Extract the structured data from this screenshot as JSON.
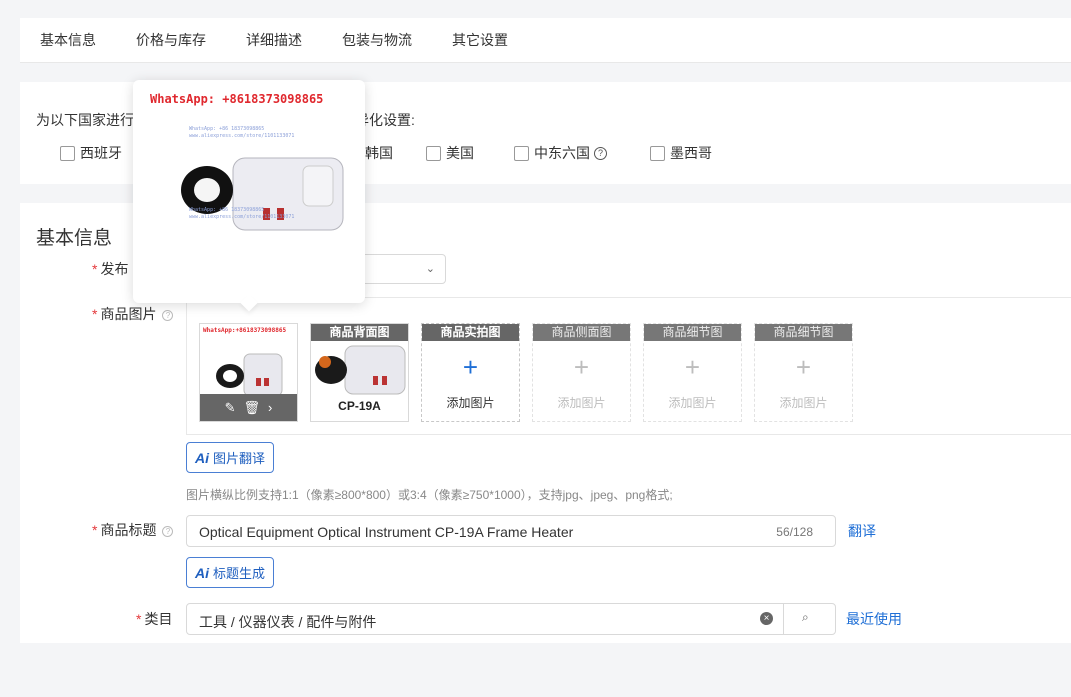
{
  "tabs": [
    "基本信息",
    "价格与库存",
    "详细描述",
    "包装与物流",
    "其它设置"
  ],
  "countries": {
    "label": "为以下国家进行差异化设置:",
    "label_visible_left": "为以下国家进行",
    "label_visible_right": "差异化设置:",
    "options": [
      "西班牙",
      "韩国",
      "美国",
      "中东六国",
      "墨西哥"
    ],
    "help_icon": "question-circle-icon"
  },
  "basic": {
    "title": "基本信息",
    "publish_label": "发布",
    "images_label": "商品图片",
    "image_slots": [
      {
        "header": "",
        "text": ""
      },
      {
        "header": "商品背面图",
        "text": "CP-19A"
      },
      {
        "header": "商品实拍图",
        "text": "添加图片"
      },
      {
        "header": "商品侧面图",
        "text": "添加图片"
      },
      {
        "header": "商品细节图",
        "text": "添加图片"
      },
      {
        "header": "商品细节图",
        "text": "添加图片"
      }
    ],
    "plus": "+",
    "ai_translate": "图片翻译",
    "ai_mark": "Ai",
    "image_tip": "图片横纵比例支持1:1（像素≥800*800）或3:4（像素≥750*1000），支持jpg、jpeg、png格式;",
    "title_label": "商品标题",
    "title_value": "Optical Equipment Optical Instrument CP-19A Frame Heater",
    "title_count": "56/128",
    "translate_link": "翻译",
    "ai_title": "标题生成",
    "category_label": "类目",
    "category_value": "工具 / 仪器仪表 / 配件与附件",
    "recent_link": "最近使用"
  },
  "popover": {
    "watermark": "WhatsApp: +8618373098865",
    "small_lines": [
      "WhatsApp: +86 18373098865",
      "www.aliexpress.com/store/1101133071"
    ]
  },
  "thumb_watermark": "WhatsApp:+8618373098865",
  "colors": {
    "accent": "#1f6fd6",
    "required": "#e4393c",
    "slot_header": "#666666"
  }
}
